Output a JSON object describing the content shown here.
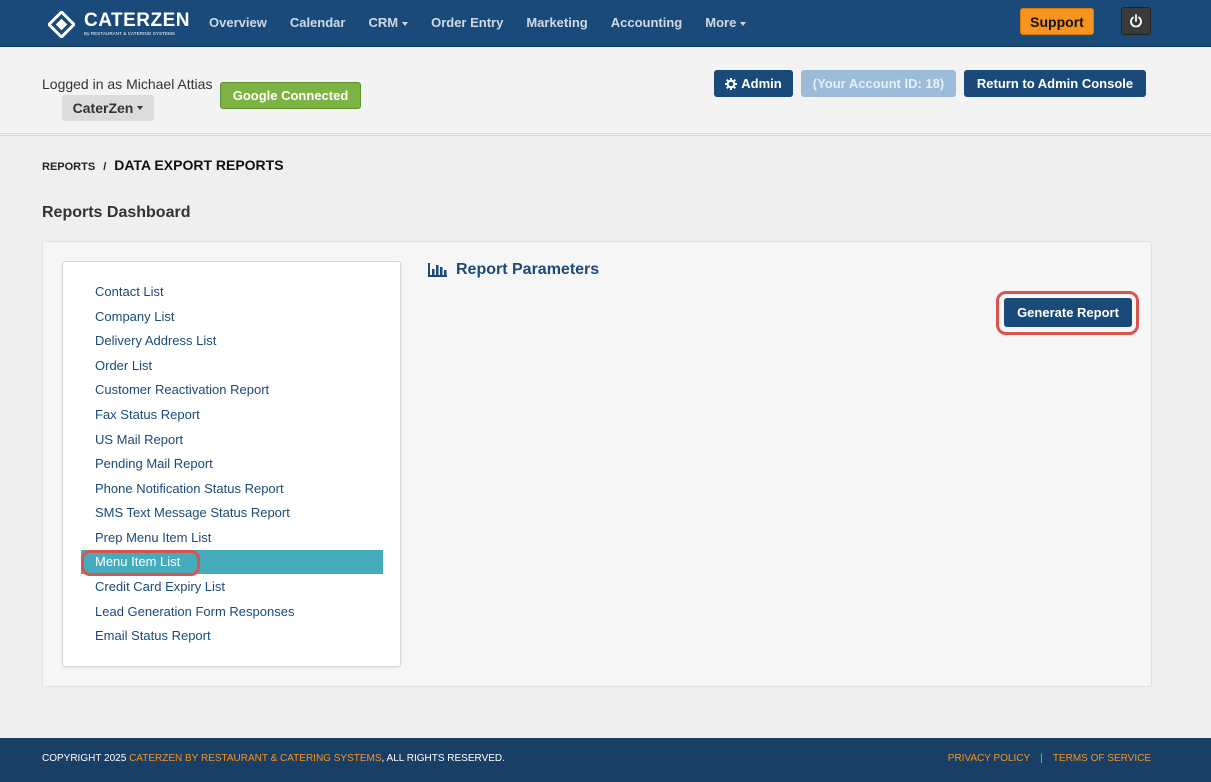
{
  "brand": {
    "name": "CATERZEN",
    "tagline": "By RESTAURANT & CATERING SYSTEMS"
  },
  "nav": {
    "items": [
      {
        "label": "Overview",
        "dropdown": false
      },
      {
        "label": "Calendar",
        "dropdown": false
      },
      {
        "label": "CRM",
        "dropdown": true
      },
      {
        "label": "Order Entry",
        "dropdown": false
      },
      {
        "label": "Marketing",
        "dropdown": false
      },
      {
        "label": "Accounting",
        "dropdown": false
      },
      {
        "label": "More",
        "dropdown": true
      }
    ],
    "support_label": "Support",
    "power_icon": "power-icon"
  },
  "account": {
    "logged_in_text": "Logged in as Michael Attias",
    "company": "CaterZen",
    "google_label": "Google Connected",
    "admin_label": "Admin",
    "account_id_label": "(Your Account ID: 18)",
    "return_label": "Return to Admin Console"
  },
  "breadcrumb": {
    "parent": "REPORTS",
    "separator": "/",
    "current": "DATA EXPORT REPORTS"
  },
  "page_title": "Reports Dashboard",
  "reports": {
    "items": [
      "Contact List",
      "Company List",
      "Delivery Address List",
      "Order List",
      "Customer Reactivation Report",
      "Fax Status Report",
      "US Mail Report",
      "Pending Mail Report",
      "Phone Notification Status Report",
      "SMS Text Message Status Report",
      "Prep Menu Item List",
      "Menu Item List",
      "Credit Card Expiry List",
      "Lead Generation Form Responses",
      "Email Status Report"
    ],
    "selected": "Menu Item List"
  },
  "params": {
    "title": "Report Parameters",
    "generate_label": "Generate Report"
  },
  "footer": {
    "copyright_prefix": "COPYRIGHT 2025 ",
    "copyright_link": "CATERZEN BY RESTAURANT & CATERING SYSTEMS",
    "copyright_suffix": ", ALL RIGHTS RESERVED.",
    "privacy": "PRIVACY POLICY",
    "terms": "TERMS OF SERVICE"
  },
  "colors": {
    "navy": "#1a4a7a",
    "orange": "#f7941d",
    "teal": "#45acbe",
    "green": "#7cb342",
    "highlight": "#d9534f"
  }
}
